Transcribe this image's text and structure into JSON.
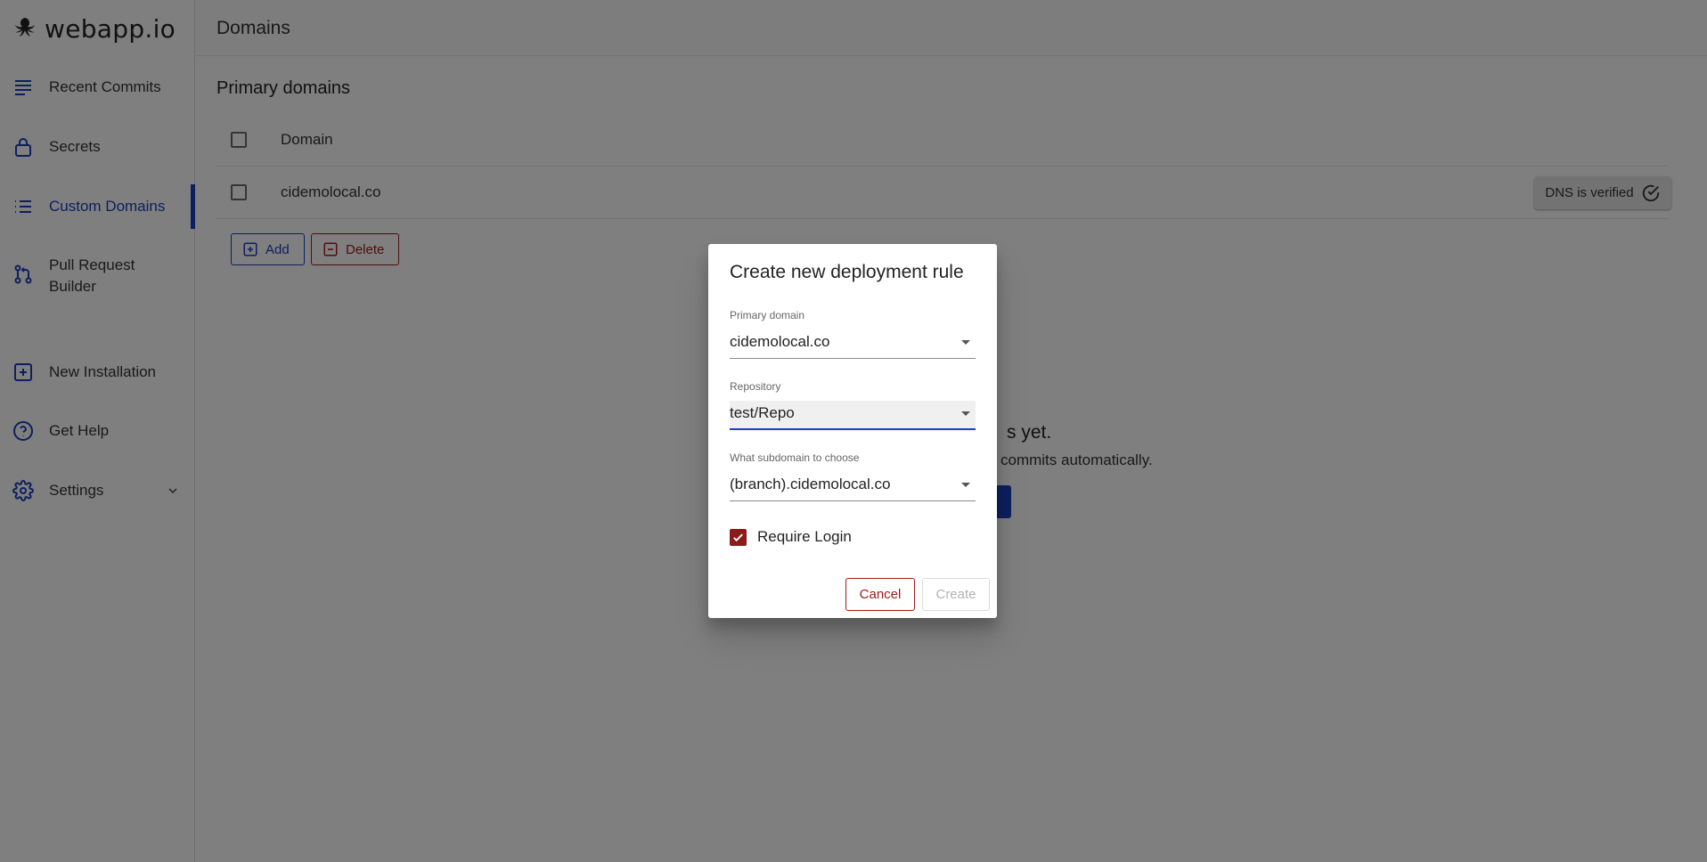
{
  "brand": {
    "name": "webapp.io"
  },
  "sidebar": {
    "items": [
      {
        "label": "Recent Commits",
        "icon": "list-lines-icon"
      },
      {
        "label": "Secrets",
        "icon": "lock-icon"
      },
      {
        "label": "Custom Domains",
        "icon": "bullet-list-icon",
        "active": true
      },
      {
        "label": "Pull Request Builder",
        "icon": "git-branch-icon"
      },
      {
        "label": "New Installation",
        "icon": "plus-square-icon"
      },
      {
        "label": "Get Help",
        "icon": "help-circle-icon"
      },
      {
        "label": "Settings",
        "icon": "gear-icon"
      }
    ]
  },
  "header": {
    "title": "Domains"
  },
  "main": {
    "section_title": "Primary domains",
    "table": {
      "column_header": "Domain",
      "rows": [
        {
          "domain": "cidemolocal.co",
          "status": "DNS is verified"
        }
      ]
    },
    "add_label": "Add",
    "delete_label": "Delete",
    "empty_title_visible": "s yet.",
    "empty_sub_visible": "w commits automatically."
  },
  "dialog": {
    "title": "Create new deployment rule",
    "primary_domain": {
      "label": "Primary domain",
      "value": "cidemolocal.co"
    },
    "repository": {
      "label": "Repository",
      "value": "test/Repo"
    },
    "subdomain": {
      "label": "What subdomain to choose",
      "value": "(branch).cidemolocal.co"
    },
    "require_login": {
      "label": "Require Login",
      "checked": true
    },
    "cancel_label": "Cancel",
    "create_label": "Create"
  },
  "colors": {
    "accent": "#1a3fbf",
    "danger": "#a01c1c",
    "checkbox_checked": "#8b1a1a",
    "overlay": "rgba(0,0,0,0.5)"
  }
}
